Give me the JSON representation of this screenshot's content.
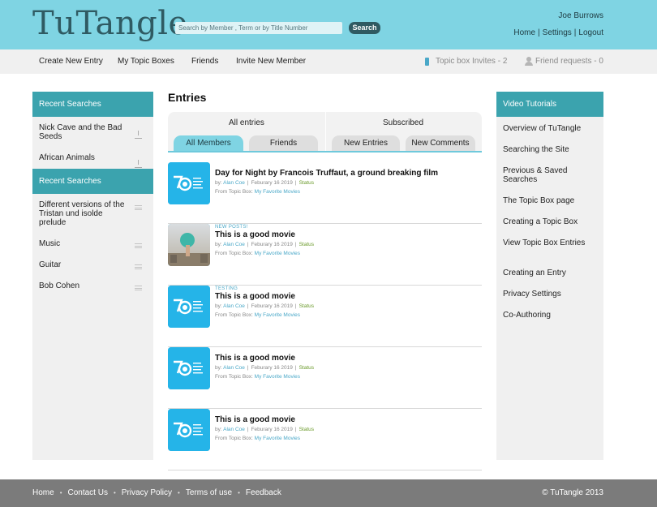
{
  "header": {
    "logo": "TuTangle",
    "search_placeholder": "Search by Member , Term or by Title Number",
    "search_button": "Search",
    "user_name": "Joe Burrows",
    "links": [
      "Home",
      "Settings",
      "Logout"
    ]
  },
  "nav": {
    "items": [
      "Create New Entry",
      "My Topic Boxes",
      "Friends",
      "Invite New Member"
    ],
    "topic_invites": "Topic box Invites - 2",
    "friend_requests": "Friend requests - 0"
  },
  "left_sidebar": {
    "recent_searches_1": {
      "heading": "Recent Searches",
      "items": [
        "Nick Cave and the Bad Seeds",
        "African Animals"
      ]
    },
    "recent_searches_2": {
      "heading": "Recent Searches",
      "items": [
        "Different versions of the Tristan und isolde prelude",
        "Music",
        "Guitar",
        "Bob Cohen"
      ]
    }
  },
  "main": {
    "title": "Entries",
    "tab_groups": {
      "all_entries": "All entries",
      "subscribed": "Subscribed"
    },
    "tabs": [
      "All Members",
      "Friends",
      "New Entries",
      "New Comments"
    ],
    "entries": [
      {
        "tag": "",
        "title": "Day for Night by Francois Truffaut, a ground breaking film",
        "by_label": "by:",
        "author": "Alan Coe",
        "date": "Feburary 16 2019",
        "status": "Status",
        "from_label": "From Topic Box:",
        "topic_box": "My Favorite Movies",
        "thumb": "logo-70"
      },
      {
        "tag": "NEW POSTS!",
        "title": "This is a good movie",
        "by_label": "by:",
        "author": "Alan Coe",
        "date": "Feburary 16 2019",
        "status": "Status",
        "from_label": "From Topic Box:",
        "topic_box": "My Favorite Movies",
        "thumb": "photo"
      },
      {
        "tag": "TESTING",
        "title": "This is a good movie",
        "by_label": "by:",
        "author": "Alan Coe",
        "date": "Feburary 16 2019",
        "status": "Status",
        "from_label": "From Topic Box:",
        "topic_box": "My Favorite Movies",
        "thumb": "logo-70"
      },
      {
        "tag": "",
        "title": "This is a good movie",
        "by_label": "by:",
        "author": "Alan Coe",
        "date": "Feburary 16 2019",
        "status": "Status",
        "from_label": "From Topic Box:",
        "topic_box": "My Favorite Movies",
        "thumb": "logo-70"
      },
      {
        "tag": "",
        "title": "This is a good movie",
        "by_label": "by:",
        "author": "Alan Coe",
        "date": "Feburary 16 2019",
        "status": "Status",
        "from_label": "From Topic Box:",
        "topic_box": "My Favorite Movies",
        "thumb": "logo-70"
      }
    ]
  },
  "right_sidebar": {
    "heading": "Video Tutorials",
    "items": [
      "Overview of TuTangle",
      "Searching the Site",
      "Previous & Saved Searches",
      "The Topic Box page",
      "Creating a Topic Box",
      "View Topic Box Entries",
      "Creating an Entry",
      "Privacy Settings",
      "Co-Authoring"
    ]
  },
  "footer": {
    "links": [
      "Home",
      "Contact Us",
      "Privacy Policy",
      "Terms of use",
      "Feedback"
    ],
    "copyright": "© TuTangle 2013"
  },
  "colors": {
    "header_bg": "#7fd4e3",
    "sidebar_head": "#3ba3ae",
    "accent_link": "#4aa8c8",
    "thumb_blue": "#25b4e8",
    "footer_bg": "#7b7b7b"
  }
}
